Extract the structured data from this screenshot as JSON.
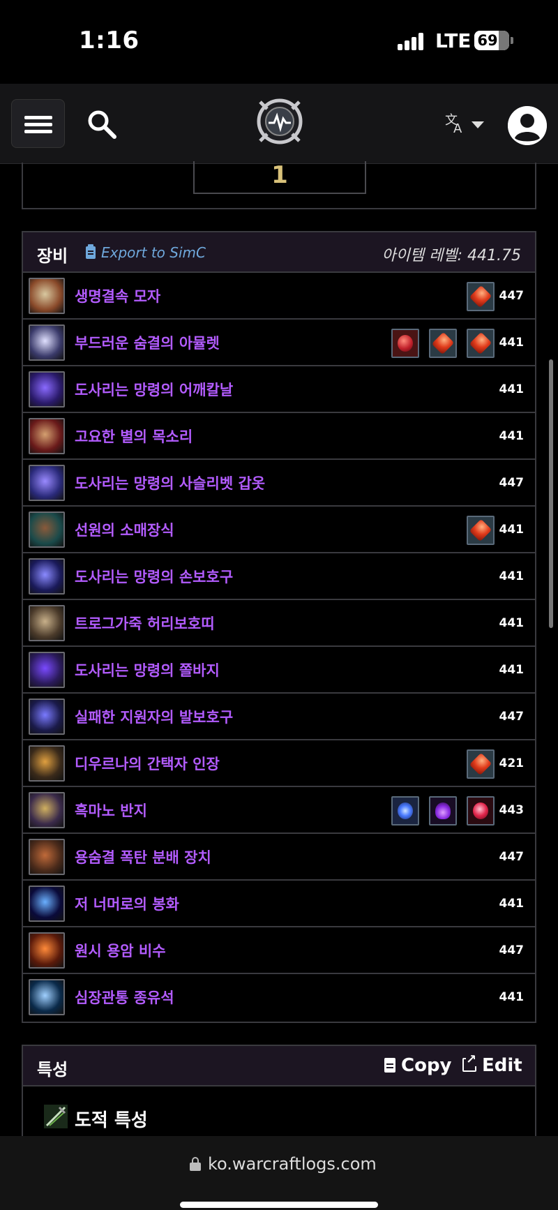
{
  "status_bar": {
    "time": "1:16",
    "network": "LTE",
    "battery": "69",
    "battery_level": 0.69
  },
  "navbar": {
    "menu_icon": "hamburger-icon",
    "search_icon": "search-icon",
    "logo_icon": "warcraftlogs-logo",
    "translate_icon": "translate-icon",
    "account_icon": "account-icon"
  },
  "previous_panel": {
    "value": "1"
  },
  "gear": {
    "title": "장비",
    "export_label": "Export to SimC",
    "item_level_label": "아이템 레벨: 441.75",
    "items": [
      {
        "name": "생명결속 모자",
        "level": "447",
        "gems": [
          "red"
        ],
        "icon_colors": [
          "#8a4a2a",
          "#d8c8a0"
        ]
      },
      {
        "name": "부드러운 숨결의 아뮬렛",
        "level": "441",
        "gems": [
          "ruby",
          "red",
          "red"
        ],
        "icon_colors": [
          "#3a3a6a",
          "#e0e0ff"
        ]
      },
      {
        "name": "도사리는 망령의 어깨칼날",
        "level": "441",
        "gems": [],
        "icon_colors": [
          "#2a1a6a",
          "#8a6aff"
        ]
      },
      {
        "name": "고요한 별의 목소리",
        "level": "441",
        "gems": [],
        "icon_colors": [
          "#6a1a1a",
          "#d4a070"
        ]
      },
      {
        "name": "도사리는 망령의 사슬리벳 갑옷",
        "level": "447",
        "gems": [],
        "icon_colors": [
          "#2a2a7a",
          "#9a8aff"
        ]
      },
      {
        "name": "선원의 소매장식",
        "level": "441",
        "gems": [
          "red"
        ],
        "icon_colors": [
          "#1a4a4a",
          "#8a5a3a"
        ]
      },
      {
        "name": "도사리는 망령의 손보호구",
        "level": "441",
        "gems": [],
        "icon_colors": [
          "#1a1a5a",
          "#8a8aff"
        ]
      },
      {
        "name": "트로그가죽 허리보호띠",
        "level": "441",
        "gems": [],
        "icon_colors": [
          "#4a3a2a",
          "#c8b08a"
        ]
      },
      {
        "name": "도사리는 망령의 쫄바지",
        "level": "441",
        "gems": [],
        "icon_colors": [
          "#2a1a5a",
          "#7a4aff"
        ]
      },
      {
        "name": "실패한 지원자의 발보호구",
        "level": "447",
        "gems": [],
        "icon_colors": [
          "#1a1a4a",
          "#7a7aff"
        ]
      },
      {
        "name": "디우르나의 간택자 인장",
        "level": "421",
        "gems": [
          "red"
        ],
        "icon_colors": [
          "#3a2a1a",
          "#e0a040"
        ]
      },
      {
        "name": "흑마노 반지",
        "level": "443",
        "gems": [
          "blue",
          "purple",
          "pink"
        ],
        "icon_colors": [
          "#3a2a4a",
          "#d0b060"
        ]
      },
      {
        "name": "용숨결 폭탄 분배 장치",
        "level": "447",
        "gems": [],
        "icon_colors": [
          "#4a2a1a",
          "#c06a3a"
        ]
      },
      {
        "name": "저 너머로의 봉화",
        "level": "441",
        "gems": [],
        "icon_colors": [
          "#0a0a3a",
          "#6ab0ff"
        ]
      },
      {
        "name": "원시 용암 비수",
        "level": "447",
        "gems": [],
        "icon_colors": [
          "#5a1a0a",
          "#ff8a3a"
        ]
      },
      {
        "name": "심장관통 종유석",
        "level": "441",
        "gems": [],
        "icon_colors": [
          "#0a2a4a",
          "#a0d0ff"
        ]
      }
    ]
  },
  "talents": {
    "title": "특성",
    "copy_label": "Copy",
    "edit_label": "Edit",
    "spec_title": "도적 특성"
  },
  "url_bar": {
    "url": "ko.warcraftlogs.com"
  },
  "colors": {
    "item_name": "#b35cff",
    "export_link": "#6fa8dc",
    "header_bg": "#1c1522",
    "border": "#3a3a3f"
  }
}
